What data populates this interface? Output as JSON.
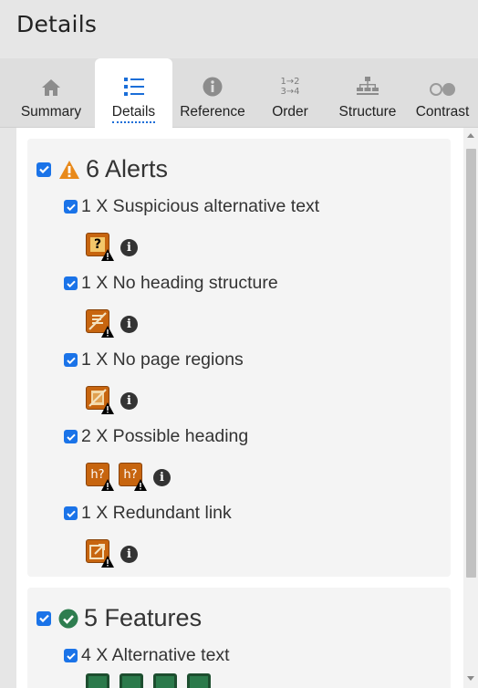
{
  "header": {
    "title": "Details"
  },
  "tabs": [
    {
      "label": "Summary",
      "icon": "home-icon"
    },
    {
      "label": "Details",
      "icon": "list-icon",
      "active": true
    },
    {
      "label": "Reference",
      "icon": "info-icon"
    },
    {
      "label": "Order",
      "icon": "order-icon",
      "glyph_a": "1→2",
      "glyph_b": "3→4"
    },
    {
      "label": "Structure",
      "icon": "structure-icon"
    },
    {
      "label": "Contrast",
      "icon": "contrast-icon"
    }
  ],
  "alerts": {
    "title": "6 Alerts",
    "icon": "warning-icon",
    "color": "#e8891a",
    "items": [
      {
        "label": "1 X Suspicious alternative text",
        "icon": "suspicious-alt-icon",
        "glyph": "?"
      },
      {
        "label": "1 X No heading structure",
        "icon": "no-heading-structure-icon",
        "glyph": ""
      },
      {
        "label": "1 X No page regions",
        "icon": "no-page-regions-icon",
        "glyph": ""
      },
      {
        "label": "2 X Possible heading",
        "icon": "possible-heading-icon",
        "glyph": "h?"
      },
      {
        "label": "1 X Redundant link",
        "icon": "redundant-link-icon",
        "glyph": ""
      }
    ]
  },
  "features": {
    "title": "5 Features",
    "icon": "check-circle-icon",
    "color": "#2e7d4f",
    "items": [
      {
        "label": "4 X Alternative text",
        "icon": "alt-text-icon"
      }
    ]
  },
  "info_glyph": "i"
}
